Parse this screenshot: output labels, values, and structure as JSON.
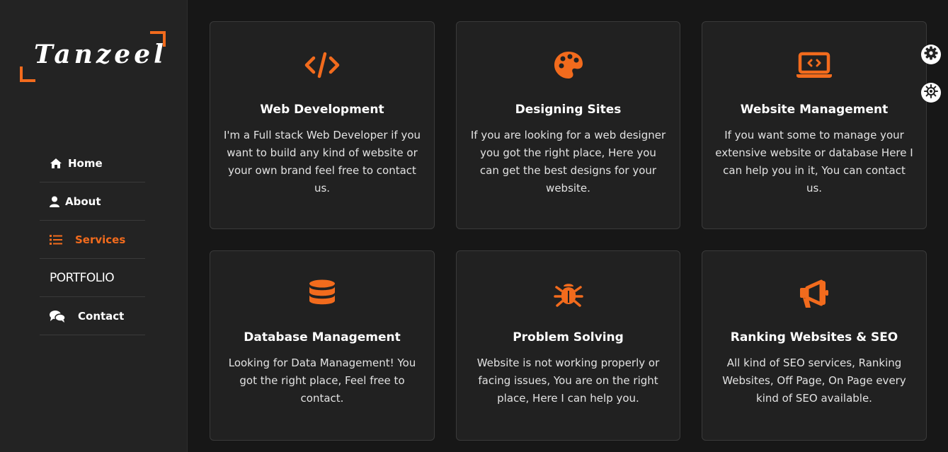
{
  "brand": {
    "logo_text": "Tanzeel",
    "accent": "#f26b1d"
  },
  "nav": [
    {
      "label": "Home",
      "icon": "home-icon",
      "active": false
    },
    {
      "label": "About",
      "icon": "user-icon",
      "active": false
    },
    {
      "label": "Services",
      "icon": "list-icon",
      "active": true
    },
    {
      "label": "PORTFOLIO",
      "icon": "",
      "active": false
    },
    {
      "label": "Contact",
      "icon": "chat-icon",
      "active": false
    }
  ],
  "services": [
    {
      "icon": "code-icon",
      "title": "Web Development",
      "desc": "I'm a Full stack Web Developer if you want to build any kind of website or your own brand feel free to contact us."
    },
    {
      "icon": "palette-icon",
      "title": "Designing Sites",
      "desc": "If you are looking for a web designer you got the right place, Here you can get the best designs for your website."
    },
    {
      "icon": "laptop-code-icon",
      "title": "Website Management",
      "desc": "If you want some to manage your extensive website or database Here I can help you in it, You can contact us."
    },
    {
      "icon": "database-icon",
      "title": "Database Management",
      "desc": "Looking for Data Management! You got the right place, Feel free to contact."
    },
    {
      "icon": "bug-icon",
      "title": "Problem Solving",
      "desc": "Website is not working properly or facing issues, You are on the right place, Here I can help you."
    },
    {
      "icon": "megaphone-icon",
      "title": "Ranking Websites & SEO",
      "desc": "All kind of SEO services, Ranking Websites, Off Page, On Page every kind of SEO available."
    }
  ],
  "controls": [
    {
      "icon": "gear-icon"
    },
    {
      "icon": "theme-toggle-icon"
    }
  ]
}
